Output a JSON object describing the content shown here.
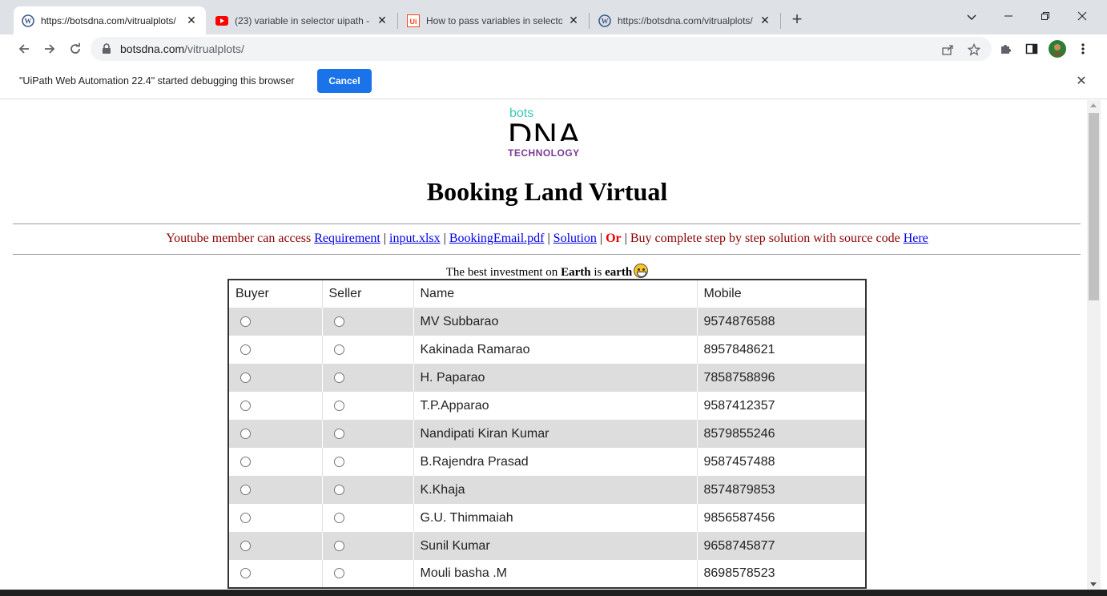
{
  "browser": {
    "tabs": [
      {
        "title": "https://botsdna.com/vitrualplots/",
        "favicon": "wordpress-icon",
        "active": true
      },
      {
        "title": "(23) variable in selector uipath - Y",
        "favicon": "youtube-icon",
        "active": false
      },
      {
        "title": "How to pass variables in selector",
        "favicon": "uipath-icon",
        "active": false
      },
      {
        "title": "https://botsdna.com/vitrualplots/",
        "favicon": "wordpress-icon",
        "active": false
      }
    ],
    "address": {
      "host": "botsdna.com",
      "path": "/vitrualplots/"
    },
    "infobar": {
      "message": "\"UiPath Web Automation 22.4\" started debugging this browser",
      "cancel_label": "Cancel"
    }
  },
  "page": {
    "logo": {
      "bots": "bots",
      "dna": "DNA",
      "tech": "TECHNOLOGY"
    },
    "title": "Booking Land Virtual",
    "links": {
      "prefix": "Youtube member can access",
      "requirement": "Requirement",
      "input": "input.xlsx",
      "email": "BookingEmail.pdf",
      "solution": "Solution",
      "or": "Or",
      "suffix": "Buy complete step by step solution with source code",
      "here": "Here"
    },
    "tagline": {
      "pre": "The best investment on",
      "earth_bold": "Earth",
      "mid": "is",
      "earth_small": "earth"
    },
    "table": {
      "headers": [
        "Buyer",
        "Seller",
        "Name",
        "Mobile"
      ],
      "rows": [
        {
          "name": "MV Subbarao",
          "mobile": "9574876588"
        },
        {
          "name": "Kakinada Ramarao",
          "mobile": "8957848621"
        },
        {
          "name": "H. Paparao",
          "mobile": "7858758896"
        },
        {
          "name": "T.P.Apparao",
          "mobile": "9587412357"
        },
        {
          "name": "Nandipati Kiran Kumar",
          "mobile": "8579855246"
        },
        {
          "name": "B.Rajendra Prasad",
          "mobile": "9587457488"
        },
        {
          "name": "K.Khaja",
          "mobile": "8574879853"
        },
        {
          "name": "G.U. Thimmaiah",
          "mobile": "9856587456"
        },
        {
          "name": "Sunil Kumar",
          "mobile": "9658745877"
        },
        {
          "name": "Mouli basha .M",
          "mobile": "8698578523"
        }
      ]
    }
  }
}
